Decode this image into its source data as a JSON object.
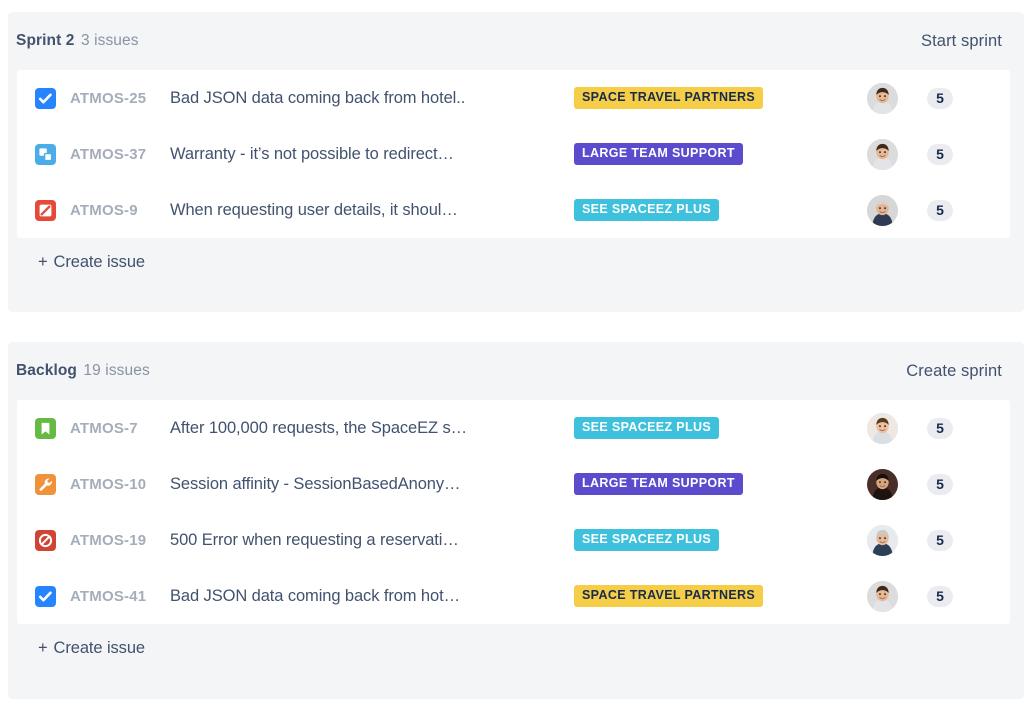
{
  "colors": {
    "panel_bg": "#f4f5f7",
    "card_bg": "#ffffff",
    "text_primary": "#42526e",
    "text_muted": "#8993a4",
    "key_color": "#a5adba",
    "epic_yellow": "#f5cd47",
    "epic_purple": "#5a4ccc",
    "epic_cyan": "#3ec1dd",
    "points_pill_bg": "#ebecf0"
  },
  "sections": [
    {
      "id": "sprint-2",
      "name": "Sprint 2",
      "count": "3 issues",
      "action_label": "Start sprint",
      "action_name": "start-sprint-button",
      "create_label": "Create issue",
      "plus": "+",
      "issues": [
        {
          "key": "ATMOS-25",
          "summary": "Bad JSON data coming back from hotel..",
          "type": "task-check",
          "type_color": "#2684ff",
          "epic": "SPACE TRAVEL PARTNERS",
          "epic_bg": "#f5cd47",
          "epic_fg": "#172b4d",
          "points": "5",
          "avatar": "avatar-man-smiling"
        },
        {
          "key": "ATMOS-37",
          "summary": "Warranty - it’s not possible to redirect…",
          "type": "subtask",
          "type_color": "#4bade8",
          "epic": "LARGE TEAM SUPPORT",
          "epic_bg": "#5a4ccc",
          "epic_fg": "#ffffff",
          "points": "5",
          "avatar": "avatar-man-smiling"
        },
        {
          "key": "ATMOS-9",
          "summary": "When requesting user details, it shoul…",
          "type": "bug-square",
          "type_color": "#e5493a",
          "epic": "SEE SPACEEZ PLUS",
          "epic_bg": "#3ec1dd",
          "epic_fg": "#ffffff",
          "points": "5",
          "avatar": "avatar-man-grey-hair"
        }
      ]
    },
    {
      "id": "backlog",
      "name": "Backlog",
      "count": "19 issues",
      "action_label": "Create sprint",
      "action_name": "create-sprint-button",
      "create_label": "Create issue",
      "plus": "+",
      "issues": [
        {
          "key": "ATMOS-7",
          "summary": "After 100,000 requests, the SpaceEZ s…",
          "type": "story-bookmark",
          "type_color": "#65ba43",
          "epic": "SEE SPACEEZ PLUS",
          "epic_bg": "#3ec1dd",
          "epic_fg": "#ffffff",
          "points": "5",
          "avatar": "avatar-woman-brown-hair"
        },
        {
          "key": "ATMOS-10",
          "summary": "Session affinity - SessionBasedAnony…",
          "type": "task-wrench",
          "type_color": "#f0923a",
          "epic": "LARGE TEAM SUPPORT",
          "epic_bg": "#5a4ccc",
          "epic_fg": "#ffffff",
          "points": "5",
          "avatar": "avatar-woman-dark-hair"
        },
        {
          "key": "ATMOS-19",
          "summary": "500 Error when requesting a reservati…",
          "type": "bug-circle",
          "type_color": "#d04437",
          "epic": "SEE SPACEEZ PLUS",
          "epic_bg": "#3ec1dd",
          "epic_fg": "#ffffff",
          "points": "5",
          "avatar": "avatar-man-bald"
        },
        {
          "key": "ATMOS-41",
          "summary": "Bad JSON data coming back from hot…",
          "type": "task-check",
          "type_color": "#2684ff",
          "epic": "SPACE TRAVEL PARTNERS",
          "epic_bg": "#f5cd47",
          "epic_fg": "#172b4d",
          "points": "5",
          "avatar": "avatar-man-smiling"
        }
      ]
    }
  ]
}
